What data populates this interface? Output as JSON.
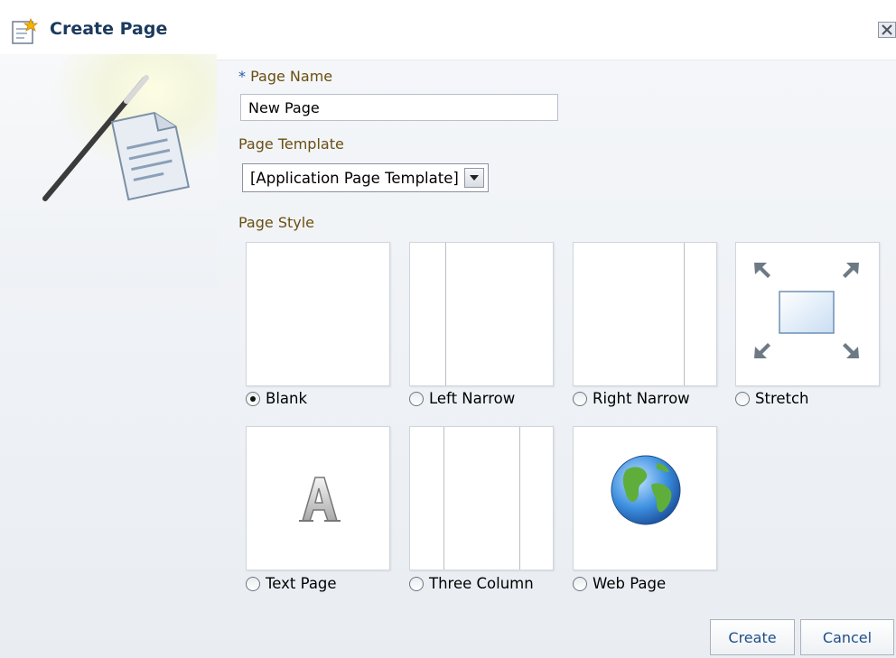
{
  "dialog": {
    "title": "Create Page"
  },
  "form": {
    "page_name": {
      "required_marker": "*",
      "label": "Page Name",
      "value": "New Page"
    },
    "page_template": {
      "label": "Page Template",
      "selected": "[Application Page Template]"
    },
    "page_style": {
      "label": "Page Style",
      "options": [
        {
          "label": "Blank",
          "selected": true
        },
        {
          "label": "Left Narrow",
          "selected": false
        },
        {
          "label": "Right Narrow",
          "selected": false
        },
        {
          "label": "Stretch",
          "selected": false
        },
        {
          "label": "Text Page",
          "selected": false
        },
        {
          "label": "Three Column",
          "selected": false
        },
        {
          "label": "Web Page",
          "selected": false
        }
      ]
    }
  },
  "buttons": {
    "create": "Create",
    "cancel": "Cancel"
  },
  "icons": {
    "title": "create-page-icon",
    "close": "close-icon",
    "wizard": "magic-wand-document-icon",
    "stretch": "stretch-arrows-icon",
    "text_page": "letter-a-icon",
    "web_page": "globe-icon"
  },
  "colors": {
    "title": "#1c3a5e",
    "label": "#6a4f12",
    "required": "#1e5fa8",
    "button_text": "#1d4e89"
  }
}
